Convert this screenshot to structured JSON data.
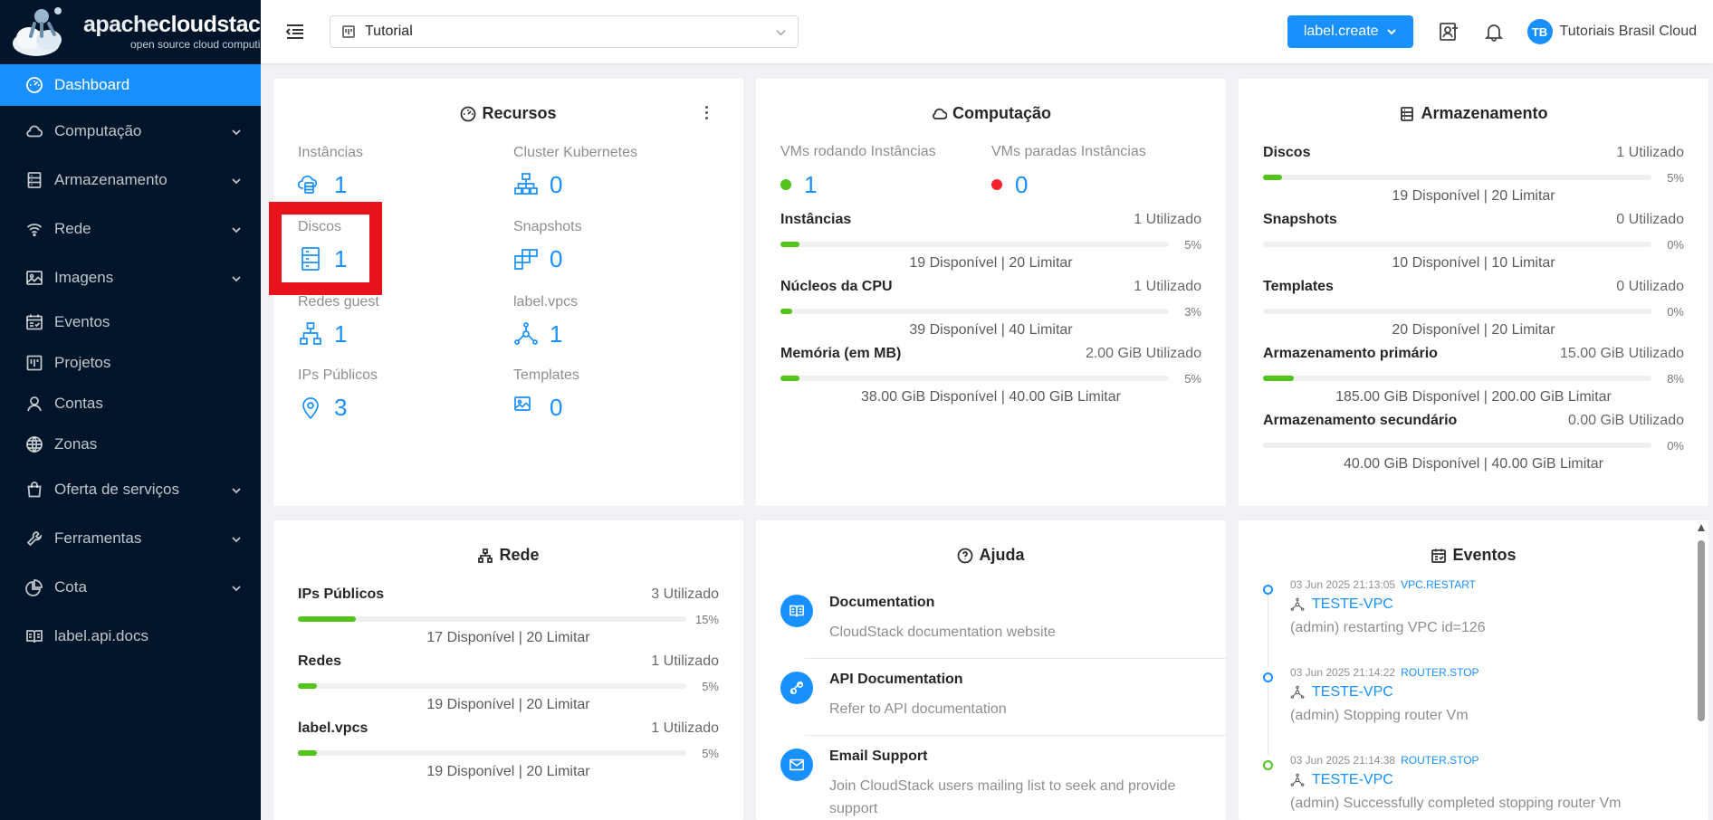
{
  "brand": {
    "title_a": "apache",
    "title_b": "cloudstack",
    "subtitle": "open source cloud computing"
  },
  "sidebar": {
    "items": [
      {
        "label": "Dashboard",
        "icon": "dashboard-icon",
        "active": true
      },
      {
        "label": "Computação",
        "icon": "cloud-icon",
        "expandable": true
      },
      {
        "label": "Armazenamento",
        "icon": "database-icon",
        "expandable": true
      },
      {
        "label": "Rede",
        "icon": "wifi-icon",
        "expandable": true
      },
      {
        "label": "Imagens",
        "icon": "picture-icon",
        "expandable": true
      },
      {
        "label": "Eventos",
        "icon": "schedule-icon"
      },
      {
        "label": "Projetos",
        "icon": "project-icon"
      },
      {
        "label": "Contas",
        "icon": "user-icon"
      },
      {
        "label": "Zonas",
        "icon": "global-icon"
      },
      {
        "label": "Oferta de serviços",
        "icon": "shopping-icon",
        "expandable": true
      },
      {
        "label": "Ferramentas",
        "icon": "tool-icon",
        "expandable": true
      },
      {
        "label": "Cota",
        "icon": "pie-chart-icon",
        "expandable": true
      },
      {
        "label": "label.api.docs",
        "icon": "read-icon"
      }
    ]
  },
  "header": {
    "project": "Tutorial",
    "create_label": "label.create",
    "user_initials": "TB",
    "user_name": "Tutoriais Brasil Cloud"
  },
  "recursos": {
    "title": "Recursos",
    "tiles": [
      {
        "label": "Instâncias",
        "value": "1",
        "icon": "cloud-server-icon"
      },
      {
        "label": "Cluster Kubernetes",
        "value": "0",
        "icon": "cluster-icon"
      },
      {
        "label": "Discos",
        "value": "1",
        "icon": "hdd-icon"
      },
      {
        "label": "Snapshots",
        "value": "0",
        "icon": "build-icon"
      },
      {
        "label": "Redes guest",
        "value": "1",
        "icon": "apartment-icon"
      },
      {
        "label": "label.vpcs",
        "value": "1",
        "icon": "deployment-unit-icon"
      },
      {
        "label": "IPs Públicos",
        "value": "3",
        "icon": "environment-icon"
      },
      {
        "label": "Templates",
        "value": "0",
        "icon": "picture-icon"
      }
    ]
  },
  "computacao": {
    "title": "Computação",
    "running_label": "VMs rodando Instâncias",
    "running_value": "1",
    "stopped_label": "VMs paradas Instâncias",
    "stopped_value": "0",
    "running_color": "#52c41a",
    "stopped_color": "#f5222d",
    "rows": [
      {
        "label": "Instâncias",
        "used": "1 Utilizado",
        "pct": "5%",
        "fraction": 0.05,
        "foot": "19 Disponível | 20 Limitar"
      },
      {
        "label": "Núcleos da CPU",
        "used": "1 Utilizado",
        "pct": "3%",
        "fraction": 0.03,
        "foot": "39 Disponível | 40 Limitar"
      },
      {
        "label": "Memória (em MB)",
        "used": "2.00 GiB Utilizado",
        "pct": "5%",
        "fraction": 0.05,
        "foot": "38.00 GiB Disponível | 40.00 GiB Limitar"
      }
    ]
  },
  "armazenamento": {
    "title": "Armazenamento",
    "rows": [
      {
        "label": "Discos",
        "used": "1 Utilizado",
        "pct": "5%",
        "fraction": 0.05,
        "foot": "19 Disponível | 20 Limitar"
      },
      {
        "label": "Snapshots",
        "used": "0 Utilizado",
        "pct": "0%",
        "fraction": 0,
        "foot": "10 Disponível | 10 Limitar"
      },
      {
        "label": "Templates",
        "used": "0 Utilizado",
        "pct": "0%",
        "fraction": 0,
        "foot": "20 Disponível | 20 Limitar"
      },
      {
        "label": "Armazenamento primário",
        "used": "15.00 GiB Utilizado",
        "pct": "8%",
        "fraction": 0.08,
        "foot": "185.00 GiB Disponível | 200.00 GiB Limitar"
      },
      {
        "label": "Armazenamento secundário",
        "used": "0.00 GiB Utilizado",
        "pct": "0%",
        "fraction": 0,
        "foot": "40.00 GiB Disponível | 40.00 GiB Limitar"
      }
    ]
  },
  "rede": {
    "title": "Rede",
    "rows": [
      {
        "label": "IPs Públicos",
        "used": "3 Utilizado",
        "pct": "15%",
        "fraction": 0.15,
        "foot": "17 Disponível | 20 Limitar"
      },
      {
        "label": "Redes",
        "used": "1 Utilizado",
        "pct": "5%",
        "fraction": 0.05,
        "foot": "19 Disponível | 20 Limitar"
      },
      {
        "label": "label.vpcs",
        "used": "1 Utilizado",
        "pct": "5%",
        "fraction": 0.05,
        "foot": "19 Disponível | 20 Limitar"
      }
    ]
  },
  "ajuda": {
    "title": "Ajuda",
    "items": [
      {
        "title": "Documentation",
        "desc": "CloudStack documentation website",
        "icon": "read-icon"
      },
      {
        "title": "API Documentation",
        "desc": "Refer to API documentation",
        "icon": "api-icon"
      },
      {
        "title": "Email Support",
        "desc": "Join CloudStack users mailing list to seek and provide support",
        "icon": "mail-icon"
      }
    ]
  },
  "eventos": {
    "title": "Eventos",
    "items": [
      {
        "time": "03 Jun 2025 21:13:05",
        "type": "VPC.RESTART",
        "resource": "TESTE-VPC",
        "desc": "(admin) restarting VPC id=126",
        "status": "blue"
      },
      {
        "time": "03 Jun 2025 21:14:22",
        "type": "ROUTER.STOP",
        "resource": "TESTE-VPC",
        "desc": "(admin) Stopping router Vm",
        "status": "blue"
      },
      {
        "time": "03 Jun 2025 21:14:38",
        "type": "ROUTER.STOP",
        "resource": "TESTE-VPC",
        "desc": "(admin) Successfully completed stopping router Vm",
        "status": "green"
      }
    ]
  },
  "colors": {
    "primary": "#1890ff",
    "sidebar_bg": "#001529",
    "progress": "#52c41a",
    "highlight": "#e8141b"
  }
}
